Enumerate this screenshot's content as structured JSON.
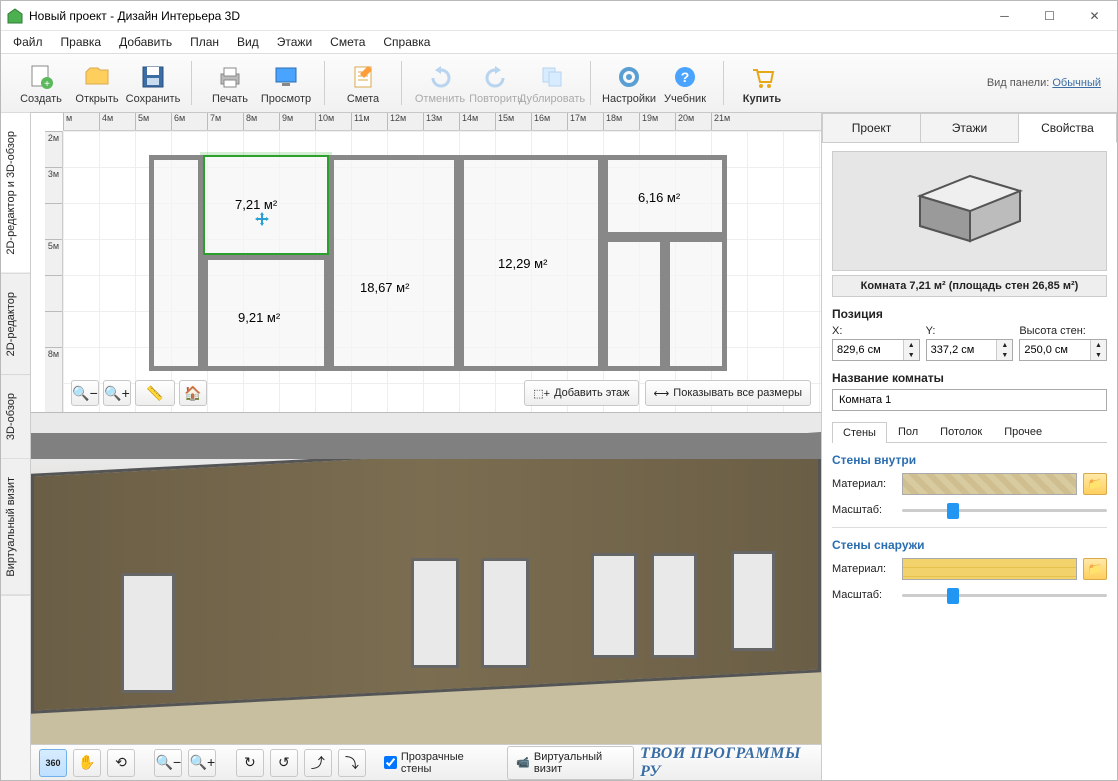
{
  "title": "Новый проект - Дизайн Интерьера 3D",
  "menu": [
    "Файл",
    "Правка",
    "Добавить",
    "План",
    "Вид",
    "Этажи",
    "Смета",
    "Справка"
  ],
  "toolbar": {
    "create": "Создать",
    "open": "Открыть",
    "save": "Сохранить",
    "print": "Печать",
    "preview": "Просмотр",
    "estimate": "Смета",
    "undo": "Отменить",
    "redo": "Повторить",
    "duplicate": "Дублировать",
    "settings": "Настройки",
    "tutorial": "Учебник",
    "buy": "Купить",
    "panel_label": "Вид панели:",
    "panel_mode": "Обычный"
  },
  "lefttabs": [
    "2D-редактор и 3D-обзор",
    "2D-редактор",
    "3D-обзор",
    "Виртуальный визит"
  ],
  "ruler_h": [
    "м",
    "4м",
    "5м",
    "6м",
    "7м",
    "8м",
    "9м",
    "10м",
    "11м",
    "12м",
    "13м",
    "14м",
    "15м",
    "16м",
    "17м",
    "18м",
    "19м",
    "20м",
    "21м"
  ],
  "ruler_v": [
    "2м",
    "3м",
    "",
    "5м",
    "",
    "",
    "8м"
  ],
  "rooms": {
    "r1": "7,21 м²",
    "r2": "6,16 м²",
    "r3": "12,29 м²",
    "r4": "18,67 м²",
    "r5": "9,21 м²"
  },
  "plan_buttons": {
    "add_floor": "Добавить этаж",
    "show_sizes": "Показывать все размеры"
  },
  "bottom": {
    "transparent": "Прозрачные стены",
    "virtual": "Виртуальный визит"
  },
  "watermark": "ТВОИ ПРОГРАММЫ РУ",
  "rtabs": [
    "Проект",
    "Этажи",
    "Свойства"
  ],
  "props": {
    "room_summary": "Комната 7,21 м²  (площадь стен 26,85 м²)",
    "position_title": "Позиция",
    "x_label": "X:",
    "y_label": "Y:",
    "h_label": "Высота стен:",
    "x": "829,6 см",
    "y": "337,2 см",
    "h": "250,0 см",
    "name_title": "Название комнаты",
    "name_value": "Комната 1",
    "subtabs": [
      "Стены",
      "Пол",
      "Потолок",
      "Прочее"
    ],
    "inside_title": "Стены внутри",
    "outside_title": "Стены снаружи",
    "material_label": "Материал:",
    "scale_label": "Масштаб:"
  }
}
